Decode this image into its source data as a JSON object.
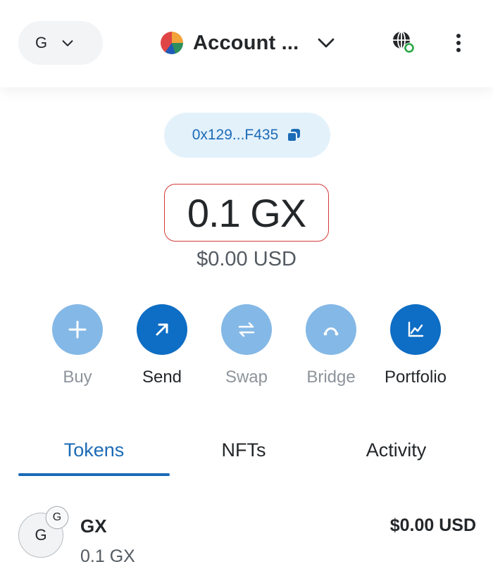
{
  "header": {
    "network": {
      "letter": "G"
    },
    "account": {
      "name": "Account ..."
    }
  },
  "address": {
    "short": "0x129...F435"
  },
  "balance": {
    "amount": "0.1 GX",
    "fiat": "$0.00 USD"
  },
  "actions": [
    {
      "label": "Buy",
      "icon": "plus-icon"
    },
    {
      "label": "Send",
      "icon": "arrow-up-right-icon"
    },
    {
      "label": "Swap",
      "icon": "swap-arrows-icon"
    },
    {
      "label": "Bridge",
      "icon": "bridge-icon"
    },
    {
      "label": "Portfolio",
      "icon": "chart-icon"
    }
  ],
  "tabs": [
    {
      "label": "Tokens",
      "active": true
    },
    {
      "label": "NFTs",
      "active": false
    },
    {
      "label": "Activity",
      "active": false
    }
  ],
  "tokens": [
    {
      "avatar_letter": "G",
      "badge_letter": "G",
      "name": "GX",
      "amount": "0.1 GX",
      "fiat_value": "$0.00 USD"
    }
  ],
  "colors": {
    "accent": "#1c6bb6",
    "primary_button": "#0e6dc4",
    "disabled_button": "#84b8e6",
    "address_pill_bg": "#e3f1fb",
    "highlight_border": "#d33a3a"
  }
}
